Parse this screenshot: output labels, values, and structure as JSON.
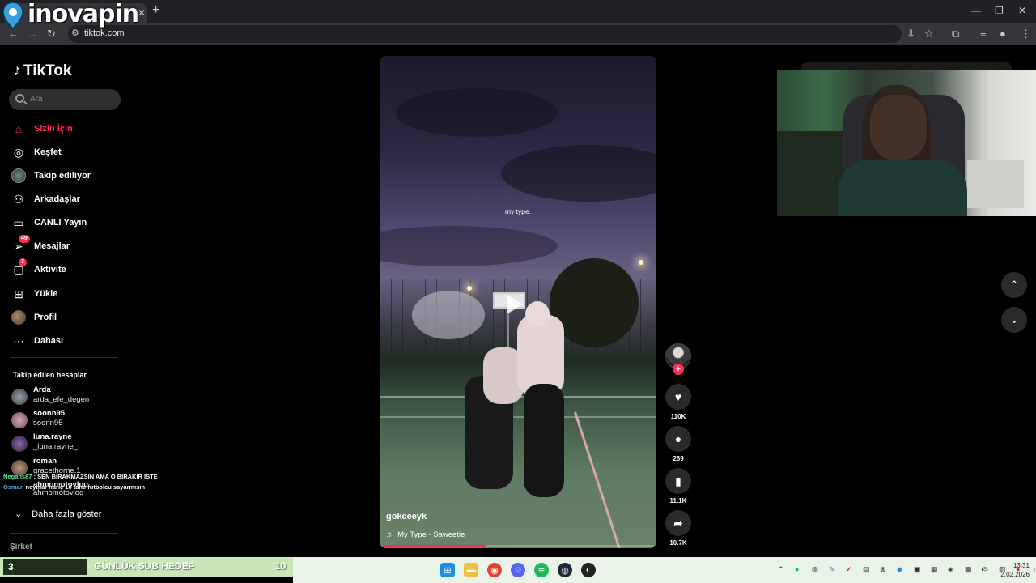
{
  "browser": {
    "url": "tiktok.com",
    "overlay_brand": "inovapin"
  },
  "tiktok": {
    "logo": "TikTok",
    "search_placeholder": "Ara",
    "nav": [
      {
        "label": "Sizin İçin",
        "icon": "home-icon",
        "active": true
      },
      {
        "label": "Keşfet",
        "icon": "compass-icon"
      },
      {
        "label": "Takip ediliyor",
        "icon": "following-avatar-icon"
      },
      {
        "label": "Arkadaşlar",
        "icon": "friends-icon"
      },
      {
        "label": "CANLI Yayın",
        "icon": "live-tv-icon"
      },
      {
        "label": "Mesajlar",
        "icon": "send-icon",
        "badge": "49"
      },
      {
        "label": "Aktivite",
        "icon": "activity-icon",
        "badge": "3"
      },
      {
        "label": "Yükle",
        "icon": "upload-plus-icon"
      },
      {
        "label": "Profil",
        "icon": "profile-avatar-icon"
      },
      {
        "label": "Dahası",
        "icon": "more-dots-icon"
      }
    ],
    "following_title": "Takip edilen hesaplar",
    "following": [
      {
        "name": "Arda",
        "username": "arda_efe_degen"
      },
      {
        "name": "soonn95",
        "username": "soonn95"
      },
      {
        "name": "luna.rayne",
        "username": "_luna.rayne_"
      },
      {
        "name": "roman",
        "username": "gracethorne.1"
      },
      {
        "name": "ahmomotovlog",
        "username": "ahmomotovlog"
      }
    ],
    "show_more": "Daha fazla göster",
    "company": "Şirket"
  },
  "chat": [
    {
      "user": "Negans87",
      "message": ": SEN BIRAKMAZSIN AMA O BIRAKIR ISTE"
    },
    {
      "user": "Osman",
      "message": "neymar hariç 10 tane futbolcu sayarmısın"
    }
  ],
  "video": {
    "caption": "my type.",
    "creator": "gokceeyk",
    "music": "My Type - Saweetie",
    "progress": 0.38,
    "likes": "110K",
    "comments": "269",
    "saves": "11.1K",
    "shares": "10.7K"
  },
  "subgoal": {
    "current": "3",
    "label": "GÜNLÜK SUB HEDEF",
    "target": "10"
  },
  "clock": {
    "time": "13:31",
    "date": "2.02.2026"
  },
  "colors": {
    "accent": "#fe2c55",
    "background": "#000000"
  }
}
